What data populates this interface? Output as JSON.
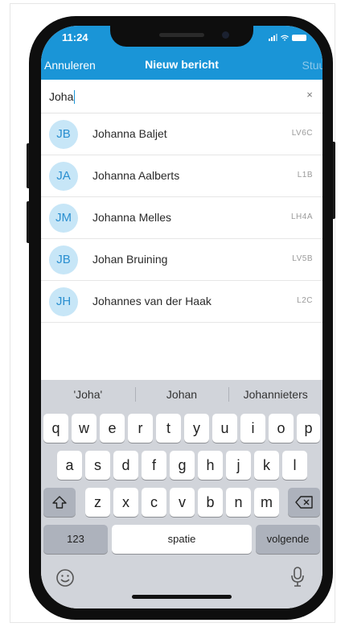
{
  "status_bar": {
    "time": "11:24"
  },
  "header": {
    "cancel_label": "Annuleren",
    "title": "Nieuw bericht",
    "send_label": "Stuur",
    "background_color": "#1a95d7"
  },
  "search": {
    "value": "Joha",
    "clear_icon": "×"
  },
  "results": [
    {
      "initials": "JB",
      "name": "Johanna  Baljet",
      "code": "LV6C"
    },
    {
      "initials": "JA",
      "name": "Johanna  Aalberts",
      "code": "L1B"
    },
    {
      "initials": "JM",
      "name": "Johanna  Melles",
      "code": "LH4A"
    },
    {
      "initials": "JB",
      "name": "Johan Bruining",
      "code": "LV5B"
    },
    {
      "initials": "JH",
      "name": "Johannes van der Haak",
      "code": "L2C"
    }
  ],
  "keyboard": {
    "suggestions": [
      "'Joha'",
      "Johan",
      "Johannieters"
    ],
    "row1": [
      "q",
      "w",
      "e",
      "r",
      "t",
      "y",
      "u",
      "i",
      "o",
      "p"
    ],
    "row2": [
      "a",
      "s",
      "d",
      "f",
      "g",
      "h",
      "j",
      "k",
      "l"
    ],
    "row3": [
      "z",
      "x",
      "c",
      "v",
      "b",
      "n",
      "m"
    ],
    "numbers_label": "123",
    "space_label": "spatie",
    "next_label": "volgende",
    "shift_icon": "shift-icon",
    "backspace_icon": "backspace-icon",
    "emoji_icon": "emoji-icon",
    "mic_icon": "microphone-icon"
  }
}
